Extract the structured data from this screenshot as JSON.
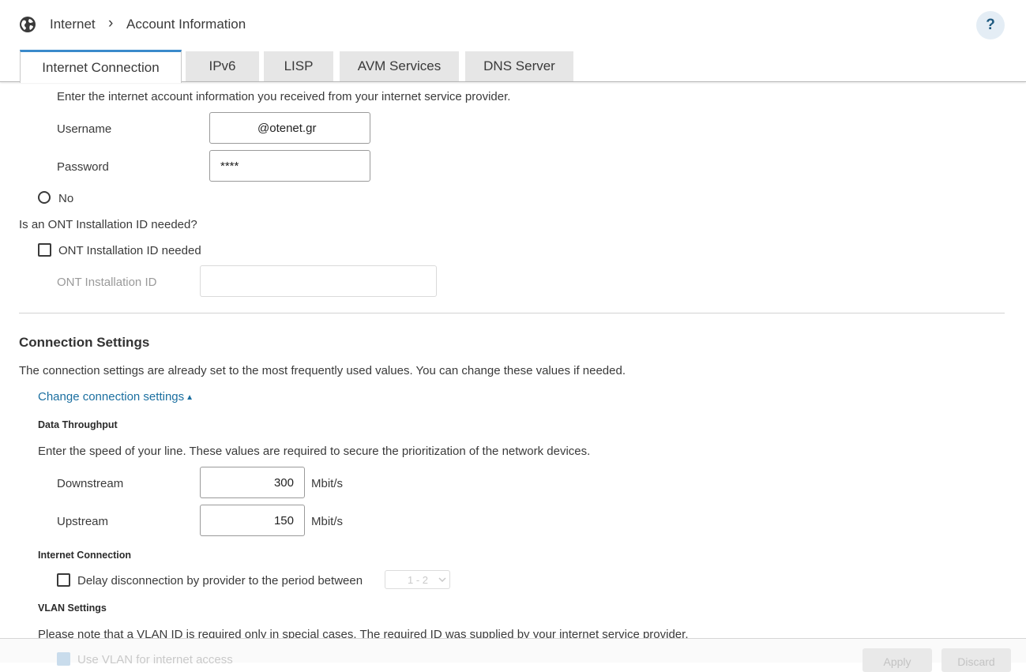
{
  "header": {
    "breadcrumb_root": "Internet",
    "breadcrumb_separator": "›",
    "breadcrumb_current": "Account Information",
    "help_label": "?"
  },
  "tabs": [
    {
      "label": "Internet Connection",
      "active": true
    },
    {
      "label": "IPv6",
      "active": false
    },
    {
      "label": "LISP",
      "active": false
    },
    {
      "label": "AVM Services",
      "active": false
    },
    {
      "label": "DNS Server",
      "active": false
    }
  ],
  "account": {
    "intro": "Enter the internet account information you received from your internet service provider.",
    "username_label": "Username",
    "username_value": "@otenet.gr",
    "password_label": "Password",
    "password_value": "****",
    "radio_no_label": "No"
  },
  "ont": {
    "question": "Is an ONT Installation ID needed?",
    "checkbox_label": "ONT Installation ID needed",
    "field_label": "ONT Installation ID",
    "field_value": ""
  },
  "connection": {
    "title": "Connection Settings",
    "description": "The connection settings are already set to the most frequently used values. You can change these values if needed.",
    "toggle_link": "Change connection settings",
    "toggle_arrow": "▲"
  },
  "throughput": {
    "title": "Data Throughput",
    "description": "Enter the speed of your line. These values are required to secure the prioritization of the network devices.",
    "downstream_label": "Downstream",
    "downstream_value": "300",
    "upstream_label": "Upstream",
    "upstream_value": "150",
    "unit": "Mbit/s"
  },
  "internet_connection": {
    "title": "Internet Connection",
    "delay_label": "Delay disconnection by provider to the period between",
    "delay_select_value": "1 - 2"
  },
  "vlan": {
    "title": "VLAN Settings",
    "description": "Please note that a VLAN ID is required only in special cases. The required ID was supplied by your internet service provider.",
    "use_vlan_label": "Use VLAN for internet access"
  },
  "footer": {
    "apply_label": "Apply",
    "discard_label": "Discard"
  },
  "colors": {
    "accent": "#3a8acb",
    "link": "#1b6fa0"
  }
}
